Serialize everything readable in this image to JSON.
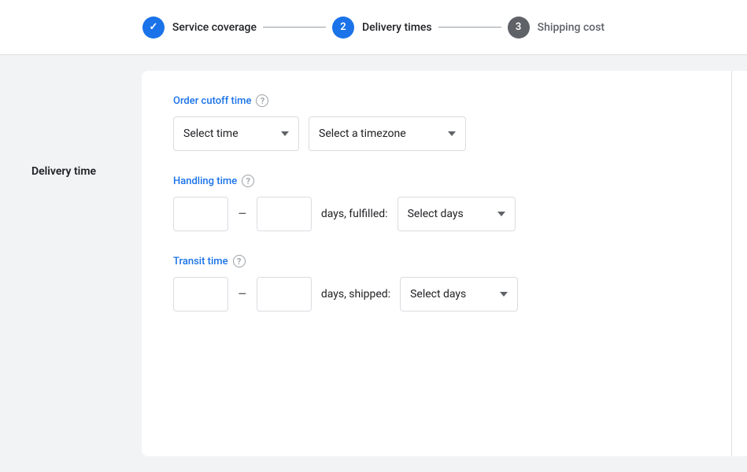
{
  "stepper": {
    "steps": [
      {
        "id": "service-coverage",
        "label": "Service coverage",
        "state": "done",
        "icon": "✓",
        "number": null
      },
      {
        "id": "delivery-times",
        "label": "Delivery times",
        "state": "active",
        "number": "2"
      },
      {
        "id": "shipping-cost",
        "label": "Shipping cost",
        "state": "inactive",
        "number": "3"
      }
    ]
  },
  "sidebar": {
    "delivery_time_label": "Delivery time"
  },
  "form": {
    "order_cutoff_label": "Order cutoff time",
    "select_time_placeholder": "Select time",
    "select_timezone_placeholder": "Select a timezone",
    "handling_time_label": "Handling time",
    "handling_days_text": "days, fulfilled:",
    "handling_select_days_label": "Select days",
    "transit_time_label": "Transit time",
    "transit_days_text": "days, shipped:",
    "transit_select_days_label": "Select days",
    "handling_min_value": "",
    "handling_max_value": "",
    "transit_min_value": "",
    "transit_max_value": ""
  },
  "help_icon_label": "?",
  "check_icon": "✓"
}
